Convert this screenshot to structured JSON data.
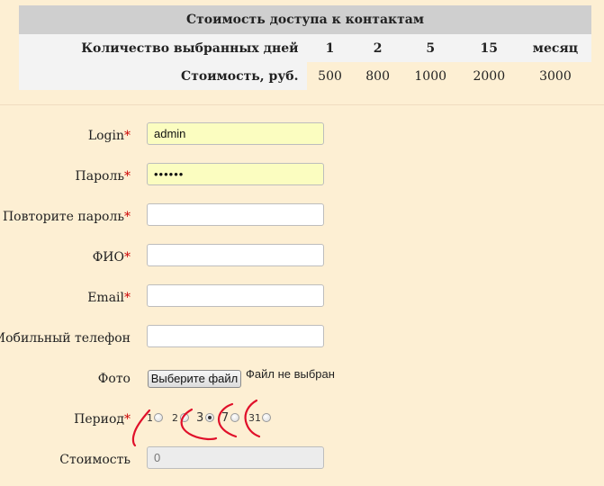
{
  "price_table": {
    "title": "Стоимость доступа к контактам",
    "days_label": "Количество выбранных дней",
    "days": [
      "1",
      "2",
      "5",
      "15",
      "месяц"
    ],
    "cost_label": "Стоимость, руб.",
    "costs": [
      "500",
      "800",
      "1000",
      "2000",
      "3000"
    ]
  },
  "form": {
    "required_mark": "*",
    "login": {
      "label": "Login",
      "value": "admin"
    },
    "password": {
      "label": "Пароль",
      "value": "••••••"
    },
    "password_repeat": {
      "label": "Повторите пароль",
      "value": ""
    },
    "fio": {
      "label": "ФИО",
      "value": ""
    },
    "email": {
      "label": "Email",
      "value": ""
    },
    "mobile": {
      "label": "Мобильный телефон",
      "value": ""
    },
    "photo": {
      "label": "Фото",
      "button": "Выберите файл",
      "status": "Файл не выбран"
    },
    "period": {
      "label": "Период",
      "options": [
        "1",
        "2",
        "3",
        "7",
        "31"
      ],
      "selected": "3"
    },
    "cost": {
      "label": "Стоимость",
      "value": "0"
    }
  },
  "annotation": {
    "color": "#e0102a"
  }
}
